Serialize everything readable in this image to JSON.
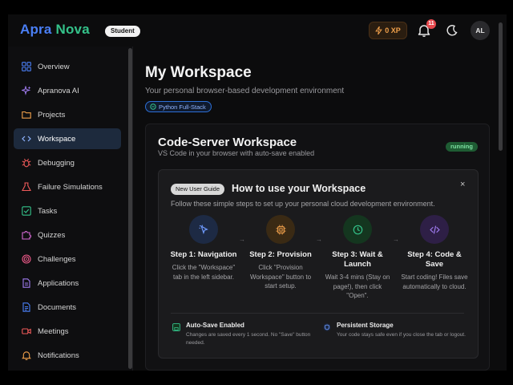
{
  "app": {
    "logo_part1": "Apra",
    "logo_part2": "Nova",
    "role": "Student",
    "xp": "0 XP",
    "notifications_count": "11",
    "user_initials": "AL",
    "colors": {
      "brand_blue": "#4a7ff5",
      "brand_green": "#34c28a",
      "active_nav": "#1d2a3d",
      "status_green": "#1e5c33"
    }
  },
  "sidebar": {
    "items": [
      {
        "label": "Overview",
        "icon": "grid-icon"
      },
      {
        "label": "Apranova AI",
        "icon": "sparkles-icon"
      },
      {
        "label": "Projects",
        "icon": "folder-icon"
      },
      {
        "label": "Workspace",
        "icon": "code-icon",
        "active": true
      },
      {
        "label": "Debugging",
        "icon": "bug-icon"
      },
      {
        "label": "Failure Simulations",
        "icon": "flask-icon"
      },
      {
        "label": "Tasks",
        "icon": "checkbox-icon"
      },
      {
        "label": "Quizzes",
        "icon": "puzzle-icon"
      },
      {
        "label": "Challenges",
        "icon": "target-icon"
      },
      {
        "label": "Applications",
        "icon": "document-icon"
      },
      {
        "label": "Documents",
        "icon": "file-icon"
      },
      {
        "label": "Meetings",
        "icon": "video-icon"
      },
      {
        "label": "Notifications",
        "icon": "bell-icon"
      }
    ]
  },
  "main": {
    "title": "My Workspace",
    "subtitle": "Your personal browser-based development environment",
    "stack": "Python Full-Stack",
    "workspace": {
      "title": "Code-Server Workspace",
      "subtitle": "VS Code in your browser with auto-save enabled",
      "status": "running"
    },
    "guide": {
      "badge": "New User Guide",
      "title": "How to use your Workspace",
      "close": "×",
      "description": "Follow these simple steps to set up your personal cloud development environment.",
      "steps": [
        {
          "title": "Step 1: Navigation",
          "desc": "Click the \"Workspace\" tab in the left sidebar.",
          "icon": "cursor-icon"
        },
        {
          "title": "Step 2: Provision",
          "desc": "Click \"Provision Workspace\" button to start setup.",
          "icon": "chip-icon"
        },
        {
          "title": "Step 3: Wait & Launch",
          "desc": "Wait 3-4 mins (Stay on page!), then click \"Open\".",
          "icon": "clock-icon"
        },
        {
          "title": "Step 4: Code & Save",
          "desc": "Start coding! Files save automatically to cloud.",
          "icon": "code-icon"
        }
      ],
      "arrow": "→",
      "features": [
        {
          "title": "Auto-Save Enabled",
          "desc": "Changes are saved every 1 second. No \"Save\" button needed.",
          "icon": "save-icon"
        },
        {
          "title": "Persistent Storage",
          "desc": "Your code stays safe even if you close the tab or logout.",
          "icon": "shield-icon"
        }
      ]
    }
  }
}
